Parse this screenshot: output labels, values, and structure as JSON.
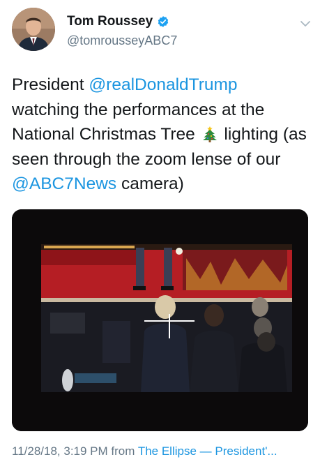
{
  "author": {
    "display_name": "Tom Roussey",
    "handle": "@tomrousseyABC7",
    "verified": true,
    "avatar_icon": "avatar-photo",
    "verified_icon": "verified-badge-icon"
  },
  "menu_icon": "chevron-down-icon",
  "tweet": {
    "text_1": "President ",
    "mention_1": "@realDonaldTrump",
    "text_2": " watching the performances at the National Christmas Tree ",
    "emoji": "christmas-tree-emoji",
    "text_3": " lighting (as seen through the zoom lense of our ",
    "mention_2": "@ABC7News",
    "text_4": " camera)"
  },
  "media": {
    "type": "photo",
    "description_icon": "camera-viewfinder-photo"
  },
  "meta": {
    "timestamp": "11/28/18, 3:19 PM",
    "from_label": "from",
    "source": "The Ellipse — President'..."
  },
  "colors": {
    "link": "#1b95e0",
    "secondary": "#657786",
    "text": "#14171a"
  }
}
